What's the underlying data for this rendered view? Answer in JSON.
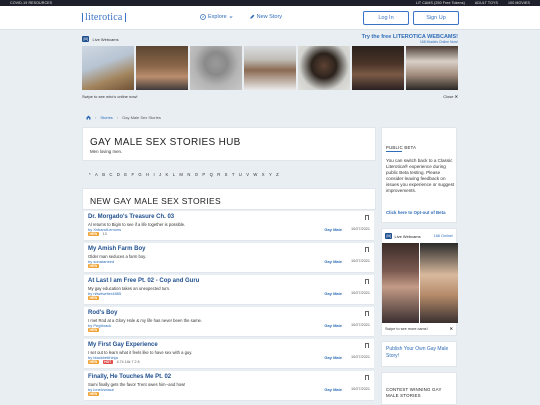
{
  "topbar": {
    "left": "COVID-19 RESOURCES",
    "right": [
      "LIT CAMS (250 Free Tokens)",
      "ADULT TOYS",
      "100 MOVIES"
    ]
  },
  "header": {
    "logo": "literotica",
    "explore": "Explore",
    "new_story": "New Story",
    "login": "Log In",
    "signup": "Sign Up"
  },
  "webcams": {
    "tag": "Live Webcams",
    "badge": "[lit]",
    "promo": "Try the free LITEROTICA WEBCAMS!",
    "online": "168 Models Online Now!",
    "swipe": "Swipe to see who's online now!",
    "close": "Close"
  },
  "breadcrumb": {
    "stories": "Stories",
    "current": "Gay Male Sex Stories"
  },
  "hub": {
    "title": "GAY MALE SEX STORIES HUB",
    "subtitle": "Men loving men."
  },
  "alphabet": [
    "*",
    "A",
    "B",
    "C",
    "D",
    "E",
    "F",
    "G",
    "H",
    "I",
    "J",
    "K",
    "L",
    "M",
    "N",
    "O",
    "P",
    "Q",
    "R",
    "S",
    "T",
    "U",
    "V",
    "W",
    "X",
    "Y",
    "Z"
  ],
  "new_title": "NEW GAY MALE SEX STORIES",
  "stories": [
    {
      "title": "Dr. Morgado's Treasure Ch. 03",
      "desc": "Al returns to Bigin to see if a life together is possible.",
      "author": "by XxbandLemons",
      "tags": [
        "NEW"
      ],
      "stats": "13",
      "cat": "Gay Male",
      "date": "10/27/2021"
    },
    {
      "title": "My Amish Farm Boy",
      "desc": "Older man seduces a farm boy.",
      "author": "by sonataneed",
      "tags": [
        "NEW"
      ],
      "stats": "",
      "cat": "Gay Male",
      "date": "10/27/2021"
    },
    {
      "title": "At Last I am Free Pt. 02 - Cop and Guru",
      "desc": "My gay education takes an unexpected turn.",
      "author": "by nitwitwriter4885",
      "tags": [
        "NEW"
      ],
      "stats": "",
      "cat": "Gay Male",
      "date": "10/27/2021"
    },
    {
      "title": "Rod's Boy",
      "desc": "I met Rod at a Glory Hole & my life has never been the same.",
      "author": "by Pegtbrack",
      "tags": [
        "NEW"
      ],
      "stats": "",
      "cat": "Gay Male",
      "date": "10/27/2021"
    },
    {
      "title": "My First Gay Experience",
      "desc": "I set out to learn what it feels like to have sex with a guy.",
      "author": "by blackbetthinja",
      "tags": [
        "NEW",
        "HOT"
      ],
      "stats": "4.74  14k  7  2  8",
      "cat": "Gay Male",
      "date": "10/27/2021"
    },
    {
      "title": "Finally, He Touches Me Pt. 02",
      "desc": "Sami finally gets the favor Trent owes him--and how!",
      "author": "by lonelvwiace",
      "tags": [
        "NEW"
      ],
      "stats": "",
      "cat": "Gay Male",
      "date": "10/27/2021"
    }
  ],
  "public_beta": {
    "title": "PUBLIC BETA",
    "body": "You can switch back to a Classic Literotica® experience during public Beta testing. Please consider leaving feedback on issues you experience or suggest improvements.",
    "link": "Click here to Opt-out of Beta"
  },
  "side_cams": {
    "tag": "Live Webcams",
    "online": "168 Online!",
    "swipe": "Swipe to see more cams!"
  },
  "publish": {
    "text": "Publish Your Own Gay Male Story!"
  },
  "contest": {
    "title": "CONTEST WINNING GAY MALE STORIES"
  },
  "colors": {
    "accent": "#2f6db8",
    "brand": "#3a73c6",
    "new_tag": "#f0a030",
    "hot_tag": "#e04c4c"
  }
}
